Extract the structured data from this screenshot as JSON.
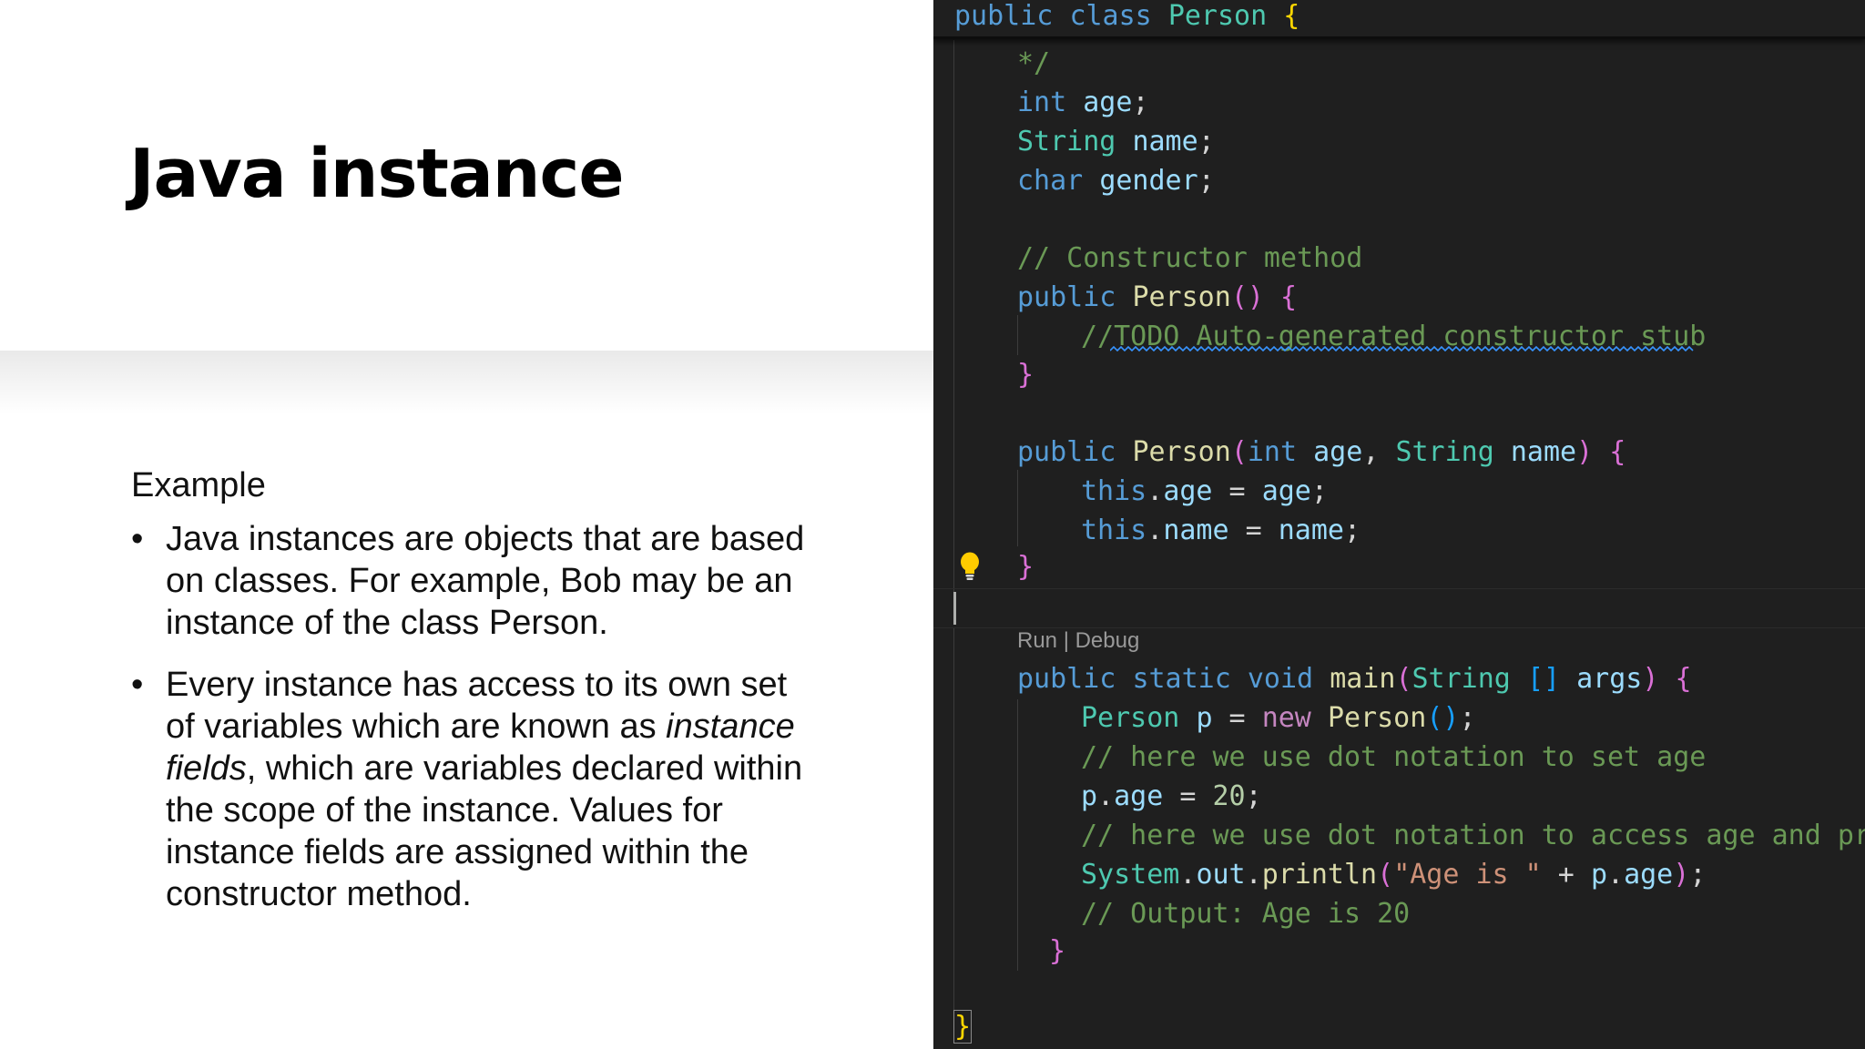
{
  "slide": {
    "title": "Java instance",
    "subheading": "Example",
    "bullet_char": "•",
    "bullets": [
      {
        "text": "Java instances are objects that are based on classes. For example, Bob may be an instance of the class Person."
      },
      {
        "pre": "Every instance has access to its own set of variables which are known as ",
        "em": "instance fields",
        "post": ", which are variables declared within the scope of the instance. Values for instance fields are assigned within the constructor method."
      }
    ]
  },
  "editor": {
    "sticky_header": {
      "kw1": "public",
      "kw2": "class",
      "name": "Person",
      "brace": "{"
    },
    "codelens": "Run | Debug",
    "tokens": {
      "public": "public",
      "static": "static",
      "void": "void",
      "new": "new",
      "this": "this",
      "int": "int",
      "String": "String",
      "char": "char",
      "Person": "Person",
      "age": "age",
      "name": "name",
      "gender": "gender",
      "p": "p",
      "args": "args",
      "main": "main",
      "System": "System",
      "out": "out",
      "println": "println",
      "comment_end": "*/",
      "comment_ctor": "// Constructor method",
      "comment_todo": "//TODO Auto-generated constructor stub",
      "comment_set": "// here we use dot notation to set age",
      "comment_access": "// here we use dot notation to access age and print",
      "comment_output": "// Output: Age is 20",
      "string_age": "\"Age is \"",
      "num_20": "20",
      "semi": ";",
      "comma": ", ",
      "dot": ".",
      "eq": " = ",
      "plus": " + ",
      "lp": "(",
      "rp": ")",
      "lb": "{",
      "rb": "}",
      "brackets": "[]"
    }
  }
}
